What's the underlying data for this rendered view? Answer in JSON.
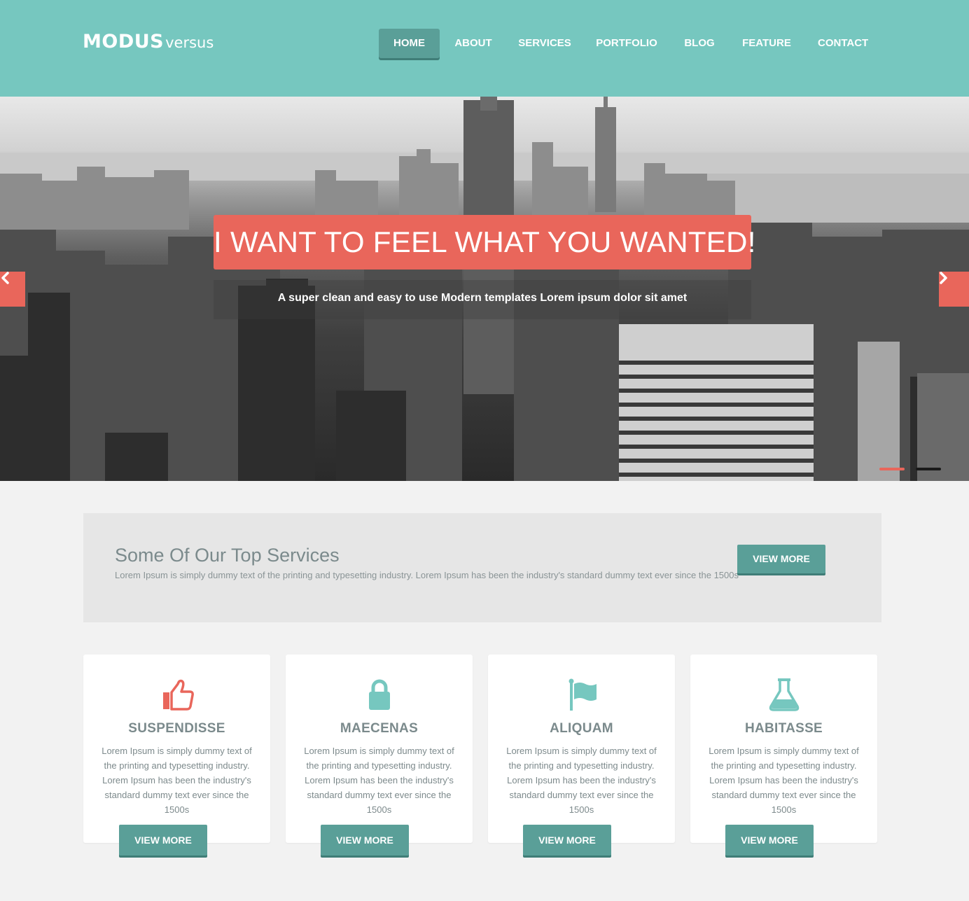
{
  "header": {
    "logo_bold": "MODUS",
    "logo_light": "versus",
    "nav": [
      {
        "label": "HOME",
        "active": true
      },
      {
        "label": "ABOUT",
        "active": false
      },
      {
        "label": "SERVICES",
        "active": false
      },
      {
        "label": "PORTFOLIO",
        "active": false
      },
      {
        "label": "BLOG",
        "active": false
      },
      {
        "label": "FEATURE",
        "active": false
      },
      {
        "label": "CONTACT",
        "active": false
      }
    ]
  },
  "hero": {
    "title": "I WANT TO FEEL WHAT YOU WANTED!",
    "subtitle": "A super clean and easy to use Modern templates Lorem ipsum dolor sit amet",
    "prev_icon": "chevron-left-icon",
    "next_icon": "chevron-right-icon",
    "slides": 2,
    "active_slide": 1
  },
  "services": {
    "title": "Some Of Our Top Services",
    "text": "Lorem Ipsum is simply dummy text of the printing and typesetting industry. Lorem Ipsum has been the industry's standard dummy text ever since the 1500s",
    "button": "VIEW MORE"
  },
  "cards": [
    {
      "icon": "thumbs-up-icon",
      "icon_color": "#e9665b",
      "title": "SUSPENDISSE",
      "text": "Lorem Ipsum is simply dummy text of the printing and typesetting industry. Lorem Ipsum has been the industry's standard dummy text ever since the 1500s",
      "button": "VIEW MORE"
    },
    {
      "icon": "lock-icon",
      "icon_color": "#76c7bf",
      "title": "MAECENAS",
      "text": "Lorem Ipsum is simply dummy text of the printing and typesetting industry. Lorem Ipsum has been the industry's standard dummy text ever since the 1500s",
      "button": "VIEW MORE"
    },
    {
      "icon": "flag-icon",
      "icon_color": "#76c7bf",
      "title": "ALIQUAM",
      "text": "Lorem Ipsum is simply dummy text of the printing and typesetting industry. Lorem Ipsum has been the industry's standard dummy text ever since the 1500s",
      "button": "VIEW MORE"
    },
    {
      "icon": "flask-icon",
      "icon_color": "#76c7bf",
      "title": "HABITASSE",
      "text": "Lorem Ipsum is simply dummy text of the printing and typesetting industry. Lorem Ipsum has been the industry's standard dummy text ever since the 1500s",
      "button": "VIEW MORE"
    }
  ],
  "colors": {
    "header_bg": "#76c7bf",
    "accent_coral": "#e9665b",
    "button_teal": "#5a9f98",
    "page_bg": "#f2f2f2"
  }
}
